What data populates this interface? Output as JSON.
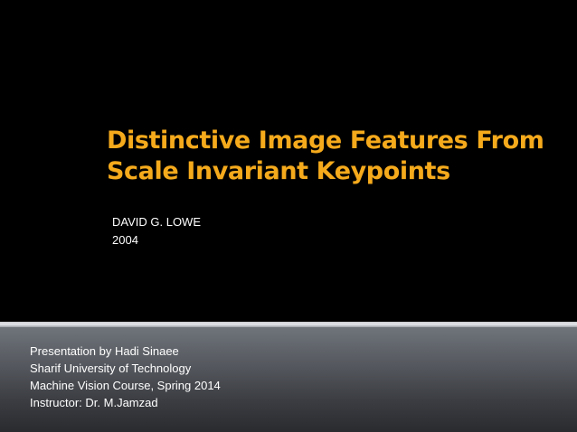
{
  "title": {
    "line1": "Distinctive Image Features From",
    "line2": "Scale Invariant Keypoints"
  },
  "subtitle": {
    "author": "DAVID G. LOWE",
    "year": "2004"
  },
  "footer": {
    "presenter": "Presentation by Hadi Sinaee",
    "university": "Sharif University of Technology",
    "course": "Machine Vision Course, Spring 2014",
    "instructor": "Instructor:  Dr. M.Jamzad"
  },
  "colors": {
    "background": "#000000",
    "title": "#f5aa1c",
    "text": "#ffffff",
    "footer_panel": "#56595f"
  }
}
